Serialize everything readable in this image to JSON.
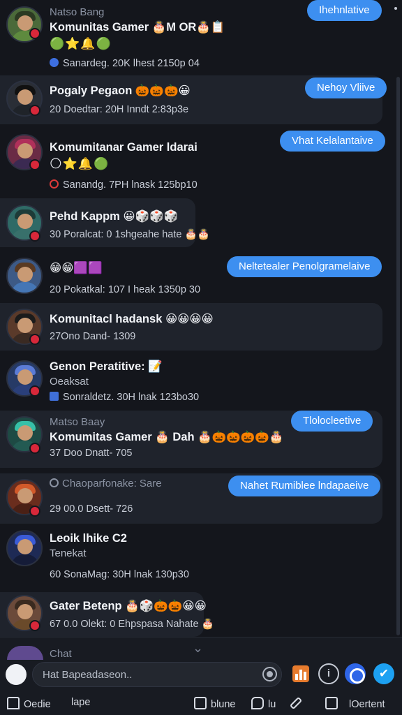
{
  "chats": [
    {
      "small_name": "Natso Bang",
      "title": "Komunitas Gamer 🎂M OR🎂📋",
      "emojis": "🟢⭐🔔🟢",
      "meta": "Sanardeg. 20K lhest 2150p 04",
      "pill": "Ihehnlative"
    },
    {
      "title": "Pogaly Pegaon 🎃🎃🎃😀",
      "meta": "20 Doedtar: 20H Inndt 2:83p3e",
      "pill": "Nehoy Vliive"
    },
    {
      "title": "Komumitanar Gamer ldarai",
      "emojis": "🌕⭐🔔🟢",
      "meta": "Sanandg. 7PH lnask 125bp10",
      "pill": "Vhat Kelalantaive"
    },
    {
      "title": "Pehd Kappm 😀🎲🎲🎲",
      "meta": "30 Poralcat: 0 1shgeahe hate 🎂🎂",
      "pill": null
    },
    {
      "title": "😁😁🟪🟪",
      "meta": "20 Pokatkal: 107 I heak 1350p 30",
      "pill": "Neltetealer Penolgramelaive"
    },
    {
      "title": "Komunitacl hadansk 😀😀😀😀",
      "meta": "27Ono Dand- 1309",
      "pill": null
    },
    {
      "title": "Genon Peratitive: 📝",
      "small_sub": "Oeaksat",
      "meta": "Sonraldetz. 30H lnak 123bo30",
      "pill": null
    },
    {
      "small_name": "Matso Baay",
      "title": "Komumitas Gamer 🎂 Dah 🎂🎃🎃🎃🎃🎂",
      "meta": "37 Doo Dnatt- 705",
      "pill": "Tlolocleetive"
    },
    {
      "small_name": "Chaoparfonake: Sare",
      "meta": "29 00.0 Dsett- 726",
      "pill": "Nahet Rumiblee lndapaeive"
    },
    {
      "title": "Leoik lhike C2",
      "small_sub": "Tenekat",
      "meta": "60 SonaMag: 30H lnak 130p30",
      "pill": null
    },
    {
      "title": "Gater Betenp 🎂🎲🎃🎃😀😀",
      "meta": "67 0.0 Olekt: 0 Ehpspasa Nahate 🎂",
      "pill": null
    }
  ],
  "peek_name": "Chat",
  "composer": {
    "placeholder": "Hat Bapeadaseon..",
    "info_label": "i"
  },
  "nav": {
    "items": [
      "Oedie",
      "lape",
      "blune",
      "lu",
      "",
      "lOertent"
    ]
  },
  "colors": {
    "accent": "#3d8ff0",
    "badge": "#d8283a",
    "background": "#14161c"
  }
}
